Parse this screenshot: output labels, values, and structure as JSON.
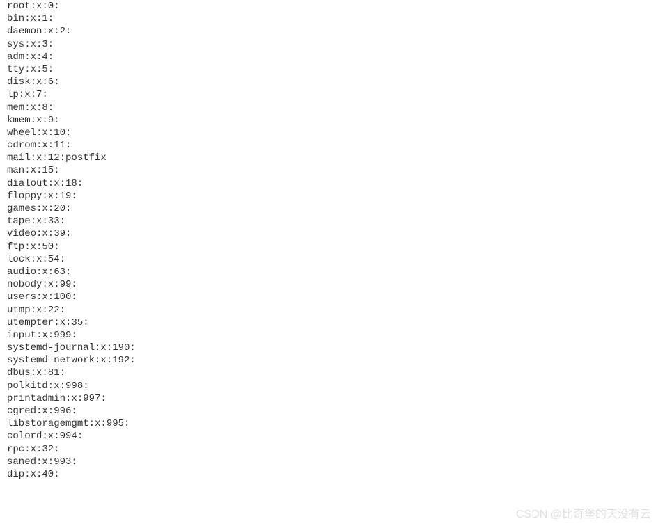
{
  "lines": [
    "root:x:0:",
    "bin:x:1:",
    "daemon:x:2:",
    "sys:x:3:",
    "adm:x:4:",
    "tty:x:5:",
    "disk:x:6:",
    "lp:x:7:",
    "mem:x:8:",
    "kmem:x:9:",
    "wheel:x:10:",
    "cdrom:x:11:",
    "mail:x:12:postfix",
    "man:x:15:",
    "dialout:x:18:",
    "floppy:x:19:",
    "games:x:20:",
    "tape:x:33:",
    "video:x:39:",
    "ftp:x:50:",
    "lock:x:54:",
    "audio:x:63:",
    "nobody:x:99:",
    "users:x:100:",
    "utmp:x:22:",
    "utempter:x:35:",
    "input:x:999:",
    "systemd-journal:x:190:",
    "systemd-network:x:192:",
    "dbus:x:81:",
    "polkitd:x:998:",
    "printadmin:x:997:",
    "cgred:x:996:",
    "libstoragemgmt:x:995:",
    "colord:x:994:",
    "rpc:x:32:",
    "saned:x:993:",
    "dip:x:40:"
  ],
  "watermark": "CSDN @比奇堡的天没有云"
}
